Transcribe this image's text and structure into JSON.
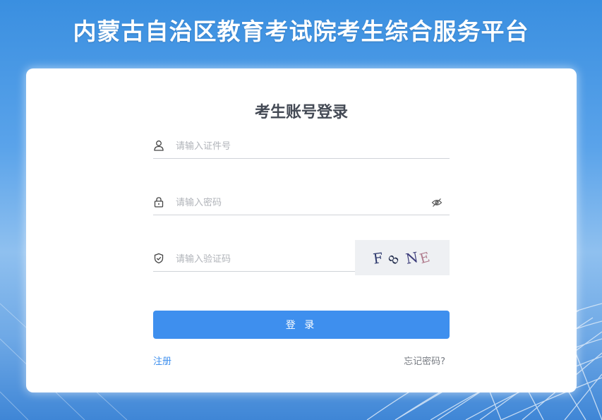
{
  "header": {
    "title": "内蒙古自治区教育考试院考生综合服务平台"
  },
  "login": {
    "title": "考生账号登录",
    "id_placeholder": "请输入证件号",
    "password_placeholder": "请输入密码",
    "captcha_placeholder": "请输入验证码",
    "captcha_text": "F8NE",
    "submit_label": "登 录",
    "register_label": "注册",
    "forgot_label": "忘记密码?"
  },
  "colors": {
    "accent": "#3e8fee",
    "title_text": "#444a55",
    "background": "#5aa3ea"
  },
  "icons": {
    "id_field": "user-icon",
    "password_field": "lock-icon",
    "captcha_field": "shield-icon",
    "password_toggle": "eye-off-icon"
  }
}
